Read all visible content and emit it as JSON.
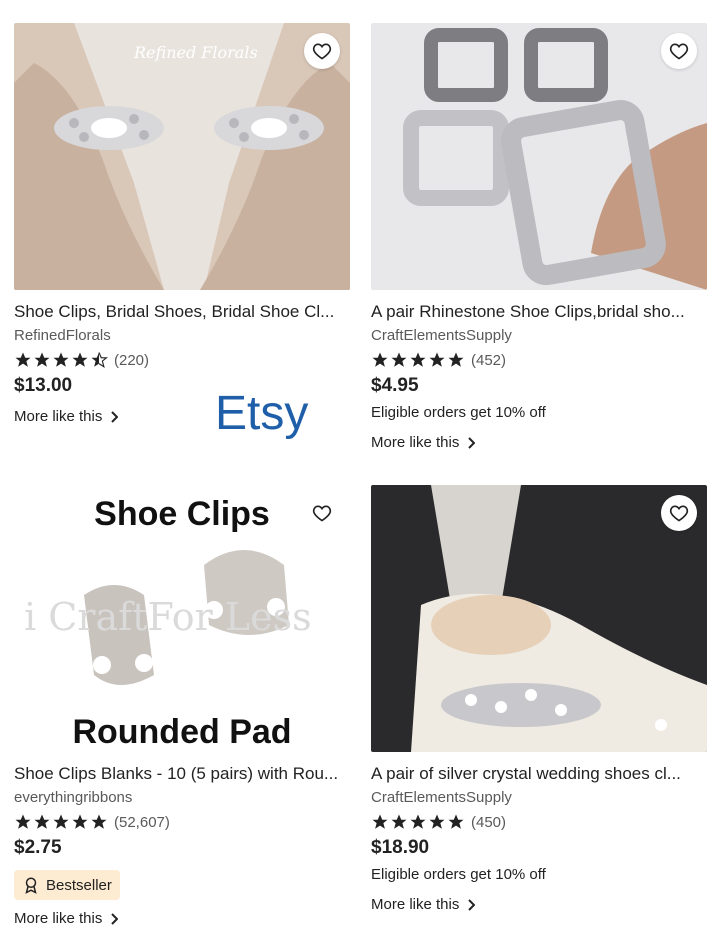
{
  "logo": "Etsy",
  "listings": [
    {
      "title": "Shoe Clips, Bridal Shoes, Bridal Shoe Cl...",
      "shop": "RefinedFlorals",
      "rating": 4.5,
      "reviews": "(220)",
      "price": "$13.00",
      "more": "More like this",
      "image_watermark": "Refined Florals"
    },
    {
      "title": "A pair Rhinestone Shoe Clips,bridal sho...",
      "shop": "CraftElementsSupply",
      "rating": 5,
      "reviews": "(452)",
      "price": "$4.95",
      "promo": "Eligible orders get 10% off",
      "more": "More like this"
    },
    {
      "title": "Shoe Clips Blanks - 10 (5 pairs) with Rou...",
      "shop": "everythingribbons",
      "rating": 5,
      "reviews": "(52,607)",
      "price": "$2.75",
      "badge": "Bestseller",
      "more": "More like this",
      "image_text_top": "Shoe Clips",
      "image_text_bottom": "Rounded Pad",
      "image_watermark": "i CraftFor Less"
    },
    {
      "title": "A pair of silver crystal wedding shoes cl...",
      "shop": "CraftElementsSupply",
      "rating": 5,
      "reviews": "(450)",
      "price": "$18.90",
      "promo": "Eligible orders get 10% off",
      "more": "More like this"
    }
  ]
}
